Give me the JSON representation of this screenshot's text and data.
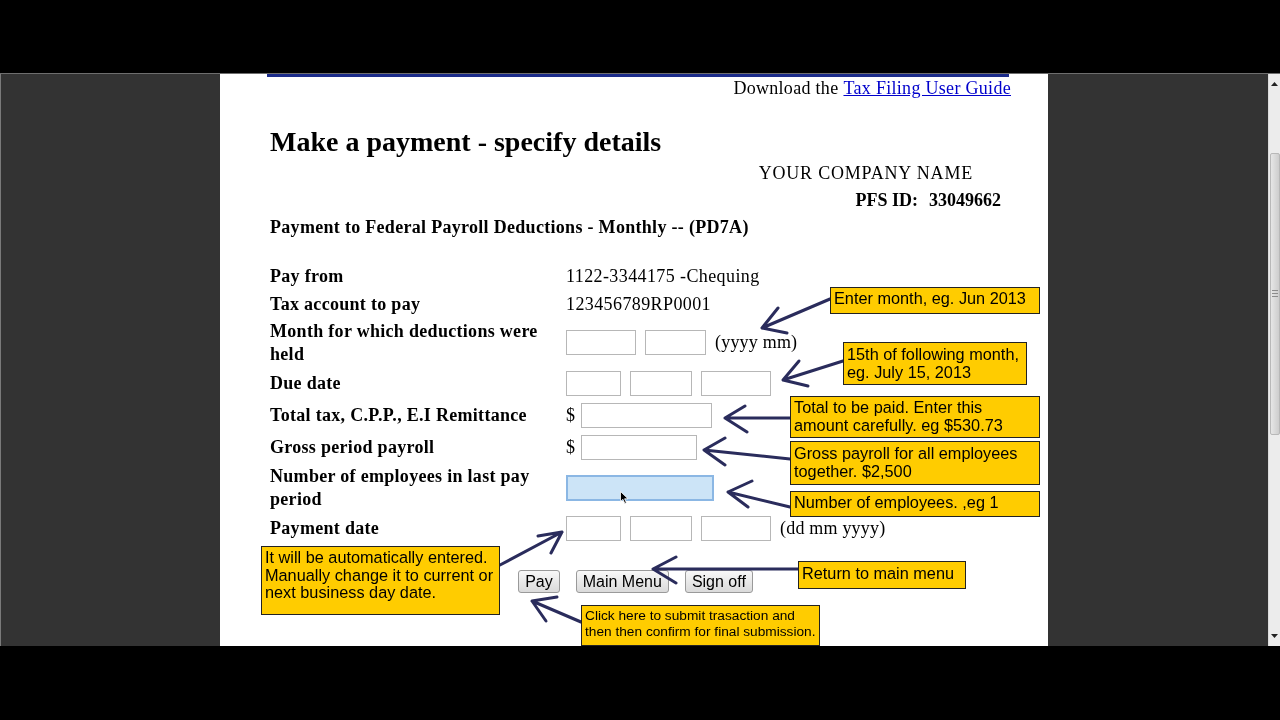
{
  "guide": {
    "text": "Download the",
    "link": "Tax Filing User Guide"
  },
  "title": "Make a payment - specify details",
  "company": {
    "name": "YOUR COMPANY NAME",
    "id_label": "PFS ID:",
    "id_value": "33049662"
  },
  "payment_to": "Payment to Federal Payroll Deductions - Monthly -- (PD7A)",
  "fields": [
    {
      "kind": "text",
      "label": "Pay from",
      "value": "1122-3344175 -Chequing"
    },
    {
      "kind": "text",
      "label": "Tax account to pay",
      "value": "123456789RP0001"
    },
    {
      "kind": "year-month",
      "label": "Month for which deductions were held",
      "hint": "(yyyy mm)",
      "focused": false
    },
    {
      "kind": "date",
      "label": "Due date",
      "focused": false
    },
    {
      "kind": "money",
      "label": "Total tax, C.P.P., E.I Remittance",
      "prefix": "$",
      "focused": false
    },
    {
      "kind": "money",
      "label": "Gross period payroll",
      "prefix": "$",
      "focused": false
    },
    {
      "kind": "number",
      "label": "Number of employees in last pay period",
      "focused": true
    },
    {
      "kind": "date",
      "label": "Payment date",
      "hint": "(dd mm yyyy)",
      "focused": false
    }
  ],
  "buttons": [
    "Pay",
    "Main Menu",
    "Sign off"
  ],
  "annotations": [
    "Enter month, eg. Jun 2013",
    "15th of following month, eg. July 15, 2013",
    "Total to be paid. Enter this amount carefully. eg $530.73",
    "Gross payroll for all employees together. $2,500",
    "Number of employees. ,eg 1",
    "It will be automatically entered. Manually change it to current or next business day date.",
    "Return to main menu",
    "Click here to submit trasaction and then then confirm for final submission."
  ]
}
